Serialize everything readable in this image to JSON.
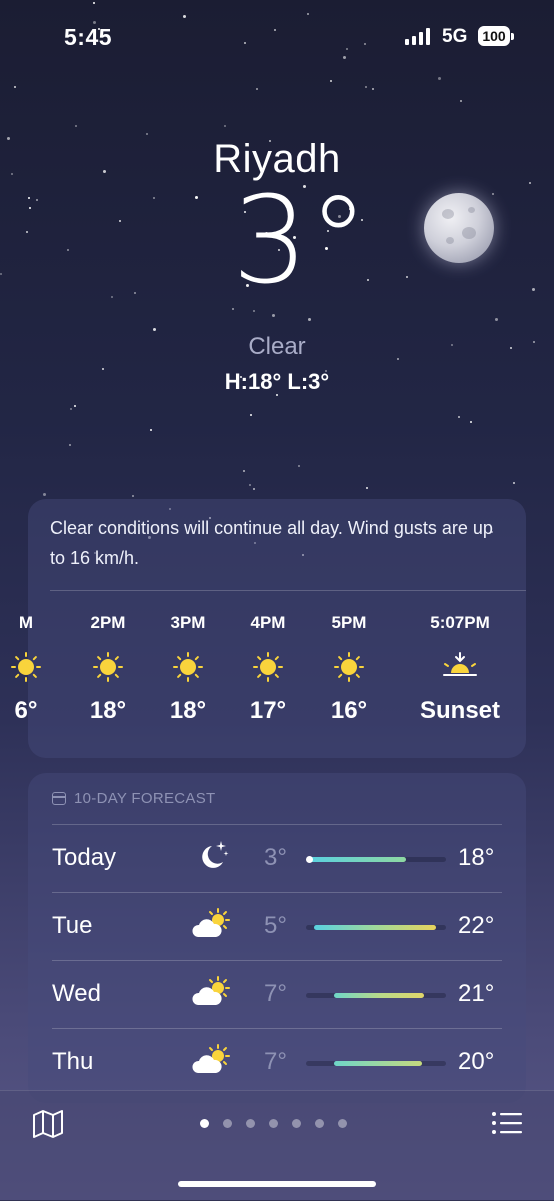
{
  "status": {
    "time": "5:45",
    "network": "5G",
    "battery": "100"
  },
  "location": {
    "city": "Riyadh",
    "temperature": "3°",
    "condition": "Clear",
    "high_low": "H:18°  L:3°"
  },
  "hourly": {
    "summary": "Clear conditions will continue all day. Wind gusts are up to 16 km/h.",
    "items": [
      {
        "time": "M",
        "icon": "sun-icon",
        "temp": "6°"
      },
      {
        "time": "2PM",
        "icon": "sun-icon",
        "temp": "18°"
      },
      {
        "time": "3PM",
        "icon": "sun-icon",
        "temp": "18°"
      },
      {
        "time": "4PM",
        "icon": "sun-icon",
        "temp": "17°"
      },
      {
        "time": "5PM",
        "icon": "sun-icon",
        "temp": "16°"
      },
      {
        "time": "5:07PM",
        "icon": "sunset-icon",
        "temp": "Sunset"
      }
    ]
  },
  "forecast": {
    "header": "10-DAY FORECAST",
    "days": [
      {
        "day": "Today",
        "icon": "moon-stars-icon",
        "low": "3°",
        "high": "18°"
      },
      {
        "day": "Tue",
        "icon": "partly-cloudy-icon",
        "low": "5°",
        "high": "22°"
      },
      {
        "day": "Wed",
        "icon": "partly-cloudy-icon",
        "low": "7°",
        "high": "21°"
      },
      {
        "day": "Thu",
        "icon": "partly-cloudy-icon",
        "low": "7°",
        "high": "20°"
      }
    ]
  },
  "bottom_bar": {
    "map_icon": "map-icon",
    "list_icon": "list-icon",
    "pages": 7,
    "active_page": 0
  },
  "colors": {
    "sun": "#f9d43c",
    "bar_cool": "#5ad1e0",
    "bar_warm": "#e8d35c",
    "background": "#222645"
  }
}
